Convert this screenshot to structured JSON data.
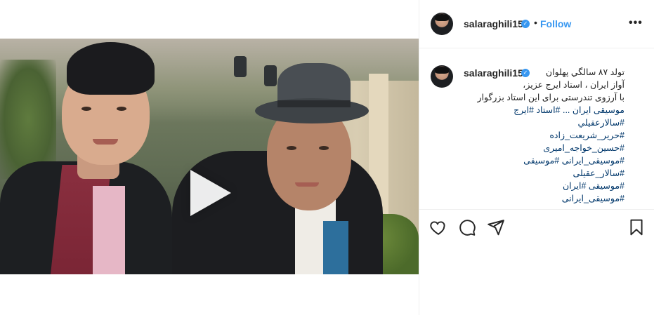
{
  "post": {
    "username": "salaraghili15",
    "follow_label": "Follow",
    "separator": "•",
    "more_label": "•••",
    "caption": {
      "lines": [
        "تولد ۸۷ سالگي پهلوان",
        "آواز ایران ، استاد ایرج عزیز،",
        "با آرزوی تندرستی برای این استاد بزرگوار",
        "موسیقی ایران ... #استاد #ایرج"
      ],
      "hashtags": [
        "#سالارعقيلي",
        "#حرير_شريعت_زاده",
        "#حسین_خواجه_امیری",
        "#موسیقی_ایرانی #موسیقی",
        "#سالار_عقیلی",
        "#موسیقی #ایران",
        "#موسیقی_ایرانی"
      ]
    },
    "icons": {
      "verified": "verified-badge-icon",
      "play": "play-icon",
      "like": "heart-icon",
      "comment": "comment-icon",
      "share": "share-icon",
      "save": "bookmark-icon"
    },
    "colors": {
      "accent": "#3897f0",
      "hashtag": "#00376b",
      "text": "#262626",
      "border": "#efefef"
    }
  }
}
